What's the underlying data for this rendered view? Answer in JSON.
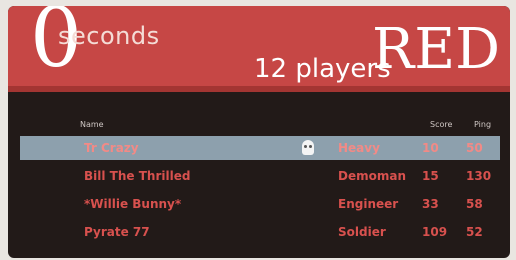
{
  "banner": {
    "countdown_digit": "0",
    "seconds_label": "seconds",
    "players_label": "12 players",
    "team_label": "RED"
  },
  "table": {
    "headers": {
      "name": "Name",
      "score": "Score",
      "ping": "Ping"
    },
    "rows": [
      {
        "name": "Tr Crazy",
        "class": "Heavy",
        "score": "10",
        "ping": "50",
        "selected": true
      },
      {
        "name": "Bill The Thrilled",
        "class": "Demoman",
        "score": "15",
        "ping": "130",
        "selected": false
      },
      {
        "name": "*Willie Bunny*",
        "class": "Engineer",
        "score": "33",
        "ping": "58",
        "selected": false
      },
      {
        "name": "Pyrate 77",
        "class": "Soldier",
        "score": "109",
        "ping": "52",
        "selected": false
      }
    ]
  },
  "colors": {
    "banner": "#c64745",
    "panel": "#221a18",
    "row_text": "#d8514e",
    "selected_row": "#8da0ad"
  }
}
